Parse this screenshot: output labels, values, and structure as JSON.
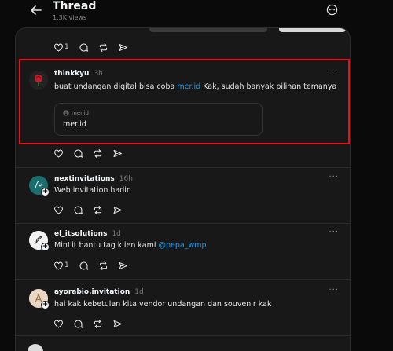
{
  "header": {
    "title": "Thread",
    "views": "1.3K views"
  },
  "top_actions": {
    "like_count": "1"
  },
  "posts": [
    {
      "username": "thinkkyu",
      "time": "3h",
      "text_before": "buat undangan digital bisa coba ",
      "text_link": "mer.id",
      "text_after": " Kak, sudah banyak pilihan temanya",
      "card": {
        "domain": "mer.id",
        "title": "mer.id"
      },
      "more": "···"
    },
    {
      "username": "nextinvitations",
      "time": "16h",
      "text": "Web invitation hadir",
      "more": "···"
    },
    {
      "username": "el_itsolutions",
      "time": "1d",
      "text_before": "MinLit bantu tag klien kami ",
      "text_link": "@pepa_wmp",
      "like_count": "1",
      "more": "···"
    },
    {
      "username": "ayorabio.invitation",
      "time": "1d",
      "text": "hai kak kebetulan kita vendor undangan dan souvenir kak",
      "more": "···"
    }
  ],
  "icons": {
    "back": "back-arrow-icon",
    "more": "more-options-icon",
    "like": "heart-icon",
    "reply": "comment-icon",
    "repost": "repost-icon",
    "share": "send-icon",
    "globe": "globe-icon"
  },
  "colors": {
    "highlight": "#e0141a",
    "link": "#1d9bf0",
    "panel": "#181818"
  }
}
